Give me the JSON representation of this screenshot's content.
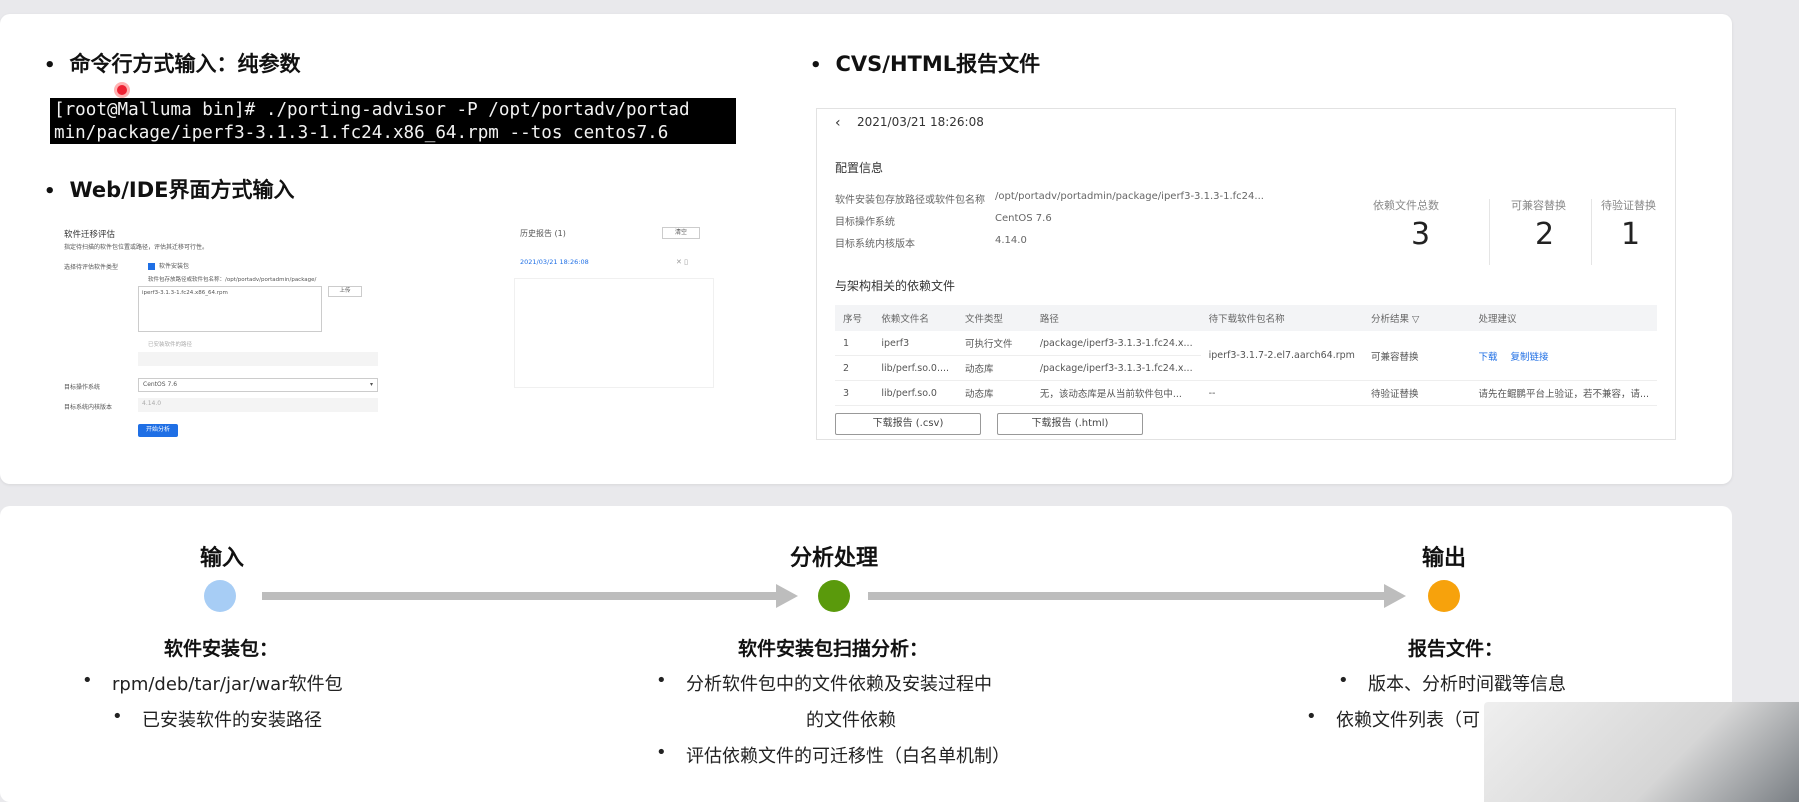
{
  "top": {
    "cmd_heading": "命令行方式输入：纯参数",
    "terminal_lines": [
      "[root@Malluma bin]# ./porting-advisor -P /opt/portadv/portad",
      "min/package/iperf3-3.1.3-1.fc24.x86_64.rpm --tos centos7.6"
    ],
    "web_heading": "Web/IDE界面方式输入",
    "report_heading": "CVS/HTML报告文件"
  },
  "ide": {
    "title": "软件迁移评估",
    "subtitle": "指定待扫描的软件包位置或路径，评估其迁移可行性。",
    "history_label": "历史报告 (1)",
    "clear_label": "清空",
    "history_item": "2021/03/21 18:26:08",
    "field_type_label": "选择待评估软件类型",
    "checkbox_label": "软件安装包",
    "path_hint": "软件包存放路径或软件包名称：/opt/portadv/portadmin/package/",
    "file_value": "iperf3-3.1.3-1.fc24.x86_64.rpm",
    "upload_label": "上传",
    "installed_hint": "已安装软件的路径",
    "os_label": "目标操作系统",
    "os_value": "CentOS 7.6",
    "kernel_label": "目标系统内核版本",
    "kernel_value": "4.14.0",
    "analyze_label": "开始分析"
  },
  "report": {
    "timestamp": "2021/03/21 18:26:08",
    "config_title": "配置信息",
    "rows": [
      {
        "label": "软件安装包存放路径或软件包名称",
        "value": "/opt/portadv/portadmin/package/iperf3-3.1.3-1.fc24..."
      },
      {
        "label": "目标操作系统",
        "value": "CentOS 7.6"
      },
      {
        "label": "目标系统内核版本",
        "value": "4.14.0"
      }
    ],
    "stats": [
      {
        "label": "依赖文件总数",
        "value": "3"
      },
      {
        "label": "可兼容替换",
        "value": "2"
      },
      {
        "label": "待验证替换",
        "value": "1"
      }
    ],
    "deps_title": "与架构相关的依赖文件",
    "columns": [
      "序号",
      "依赖文件名",
      "文件类型",
      "路径",
      "待下载软件包名称",
      "分析结果",
      "处理建议"
    ],
    "table": [
      [
        "1",
        "iperf3",
        "可执行文件",
        "/package/iperf3-3.1.3-1.fc24.x...",
        "iperf3-3.1.7-2.el7.aarch64.rpm",
        "可兼容替换",
        ""
      ],
      [
        "2",
        "lib/perf.so.0....",
        "动态库",
        "/package/iperf3-3.1.3-1.fc24.x...",
        "",
        "",
        ""
      ],
      [
        "3",
        "lib/perf.so.0",
        "动态库",
        "无，该动态库是从当前软件包中...",
        "--",
        "待验证替换",
        "请先在鲲鹏平台上验证，若不兼容，请..."
      ]
    ],
    "link_download": "下载",
    "link_copy": "复制链接",
    "btn_csv": "下载报告 (.csv)",
    "btn_html": "下载报告 (.html)"
  },
  "flow": {
    "stages": [
      {
        "title": "输入",
        "color": "#a7cdf5",
        "sub": "软件安装包：",
        "items": [
          "rpm/deb/tar/jar/war软件包",
          "已安装软件的安装路径"
        ]
      },
      {
        "title": "分析处理",
        "color": "#5a9a0c",
        "sub": "软件安装包扫描分析：",
        "items": [
          "分析软件包中的文件依赖及安装过程中",
          "的文件依赖",
          "评估依赖文件的可迁移性（白名单机制）"
        ]
      },
      {
        "title": "输出",
        "color": "#f7a20c",
        "sub": "报告文件：",
        "items": [
          "版本、分析时间戳等信息",
          "依赖文件列表（可"
        ]
      }
    ]
  }
}
